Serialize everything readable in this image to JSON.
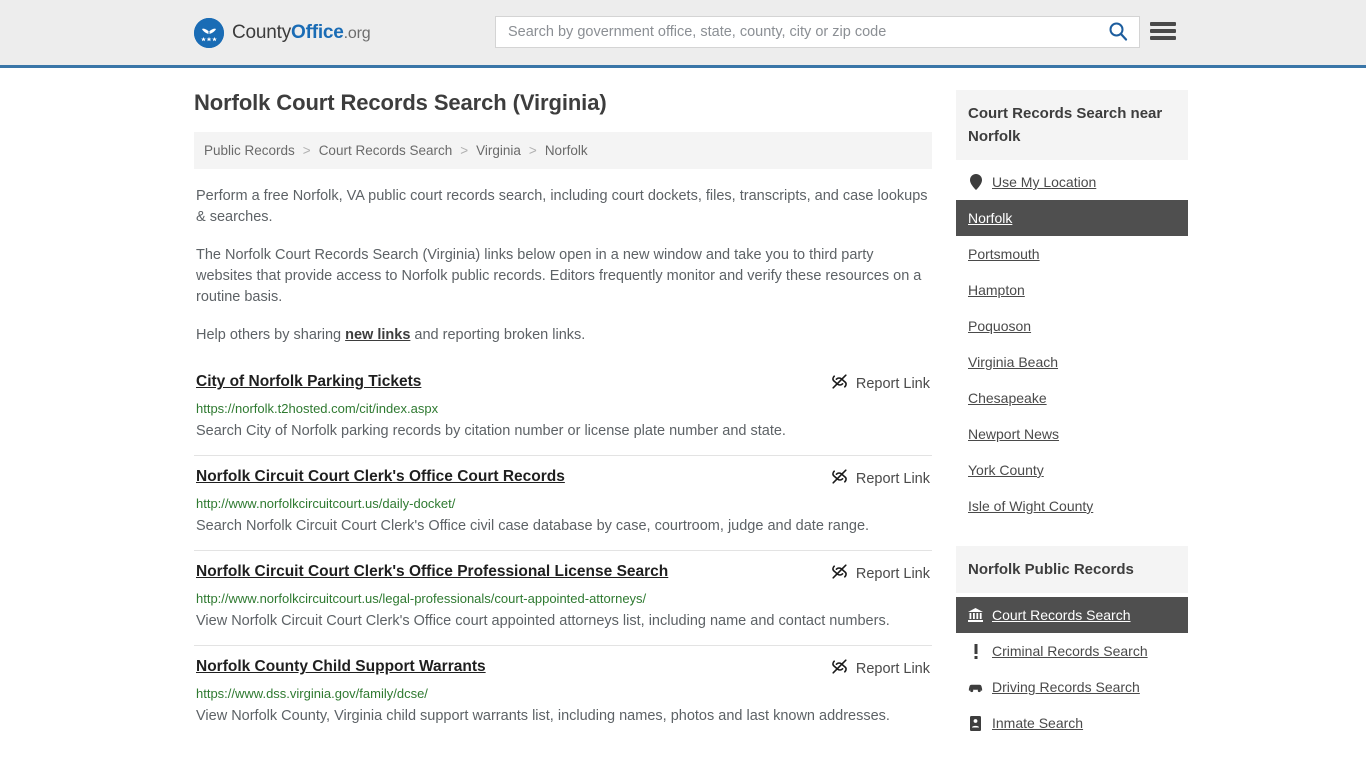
{
  "header": {
    "brand": {
      "part1": "County",
      "part2": "Office",
      "part3": ".org",
      "logo_icon": "eagle-stars-logo"
    },
    "search": {
      "placeholder": "Search by government office, state, county, city or zip code",
      "value": "",
      "button_icon": "search-icon"
    },
    "menu_icon": "hamburger-menu-icon"
  },
  "main": {
    "title": "Norfolk Court Records Search (Virginia)",
    "breadcrumb": {
      "items": [
        "Public Records",
        "Court Records Search",
        "Virginia",
        "Norfolk"
      ],
      "separator": ">"
    },
    "intro": {
      "p1": "Perform a free Norfolk, VA public court records search, including court dockets, files, transcripts, and case lookups & searches.",
      "p2": "The Norfolk Court Records Search (Virginia) links below open in a new window and take you to third party websites that provide access to Norfolk public records. Editors frequently monitor and verify these resources on a routine basis.",
      "p3_before": "Help others by sharing ",
      "p3_link": "new links",
      "p3_after": " and reporting broken links."
    },
    "report_link_label": "Report Link",
    "report_link_icon": "broken-link-icon",
    "results": [
      {
        "title": "City of Norfolk Parking Tickets",
        "url": "https://norfolk.t2hosted.com/cit/index.aspx",
        "description": "Search City of Norfolk parking records by citation number or license plate number and state."
      },
      {
        "title": "Norfolk Circuit Court Clerk's Office Court Records",
        "url": "http://www.norfolkcircuitcourt.us/daily-docket/",
        "description": "Search Norfolk Circuit Court Clerk's Office civil case database by case, courtroom, judge and date range."
      },
      {
        "title": "Norfolk Circuit Court Clerk's Office Professional License Search",
        "url": "http://www.norfolkcircuitcourt.us/legal-professionals/court-appointed-attorneys/",
        "description": "View Norfolk Circuit Court Clerk's Office court appointed attorneys list, including name and contact numbers."
      },
      {
        "title": "Norfolk County Child Support Warrants",
        "url": "https://www.dss.virginia.gov/family/dcse/",
        "description": "View Norfolk County, Virginia child support warrants list, including names, photos and last known addresses."
      }
    ]
  },
  "sidebar": {
    "nearby": {
      "heading": "Court Records Search near Norfolk",
      "use_location": {
        "label": "Use My Location",
        "icon": "map-pin-icon"
      },
      "items": [
        {
          "label": "Norfolk",
          "active": true
        },
        {
          "label": "Portsmouth",
          "active": false
        },
        {
          "label": "Hampton",
          "active": false
        },
        {
          "label": "Poquoson",
          "active": false
        },
        {
          "label": "Virginia Beach",
          "active": false
        },
        {
          "label": "Chesapeake",
          "active": false
        },
        {
          "label": "Newport News",
          "active": false
        },
        {
          "label": "York County",
          "active": false
        },
        {
          "label": "Isle of Wight County",
          "active": false
        }
      ]
    },
    "public_records": {
      "heading": "Norfolk Public Records",
      "items": [
        {
          "label": "Court Records Search",
          "icon": "courthouse-icon",
          "active": true
        },
        {
          "label": "Criminal Records Search",
          "icon": "exclamation-icon",
          "active": false
        },
        {
          "label": "Driving Records Search",
          "icon": "car-icon",
          "active": false
        },
        {
          "label": "Inmate Search",
          "icon": "id-card-icon",
          "active": false
        }
      ]
    }
  },
  "colors": {
    "accent_blue": "#1a6cb5",
    "header_border": "#3a76a8",
    "header_bg": "#ededed",
    "url_green": "#2f7a31",
    "active_dark": "#4f4f4f",
    "panel_gray": "#f4f4f4"
  }
}
